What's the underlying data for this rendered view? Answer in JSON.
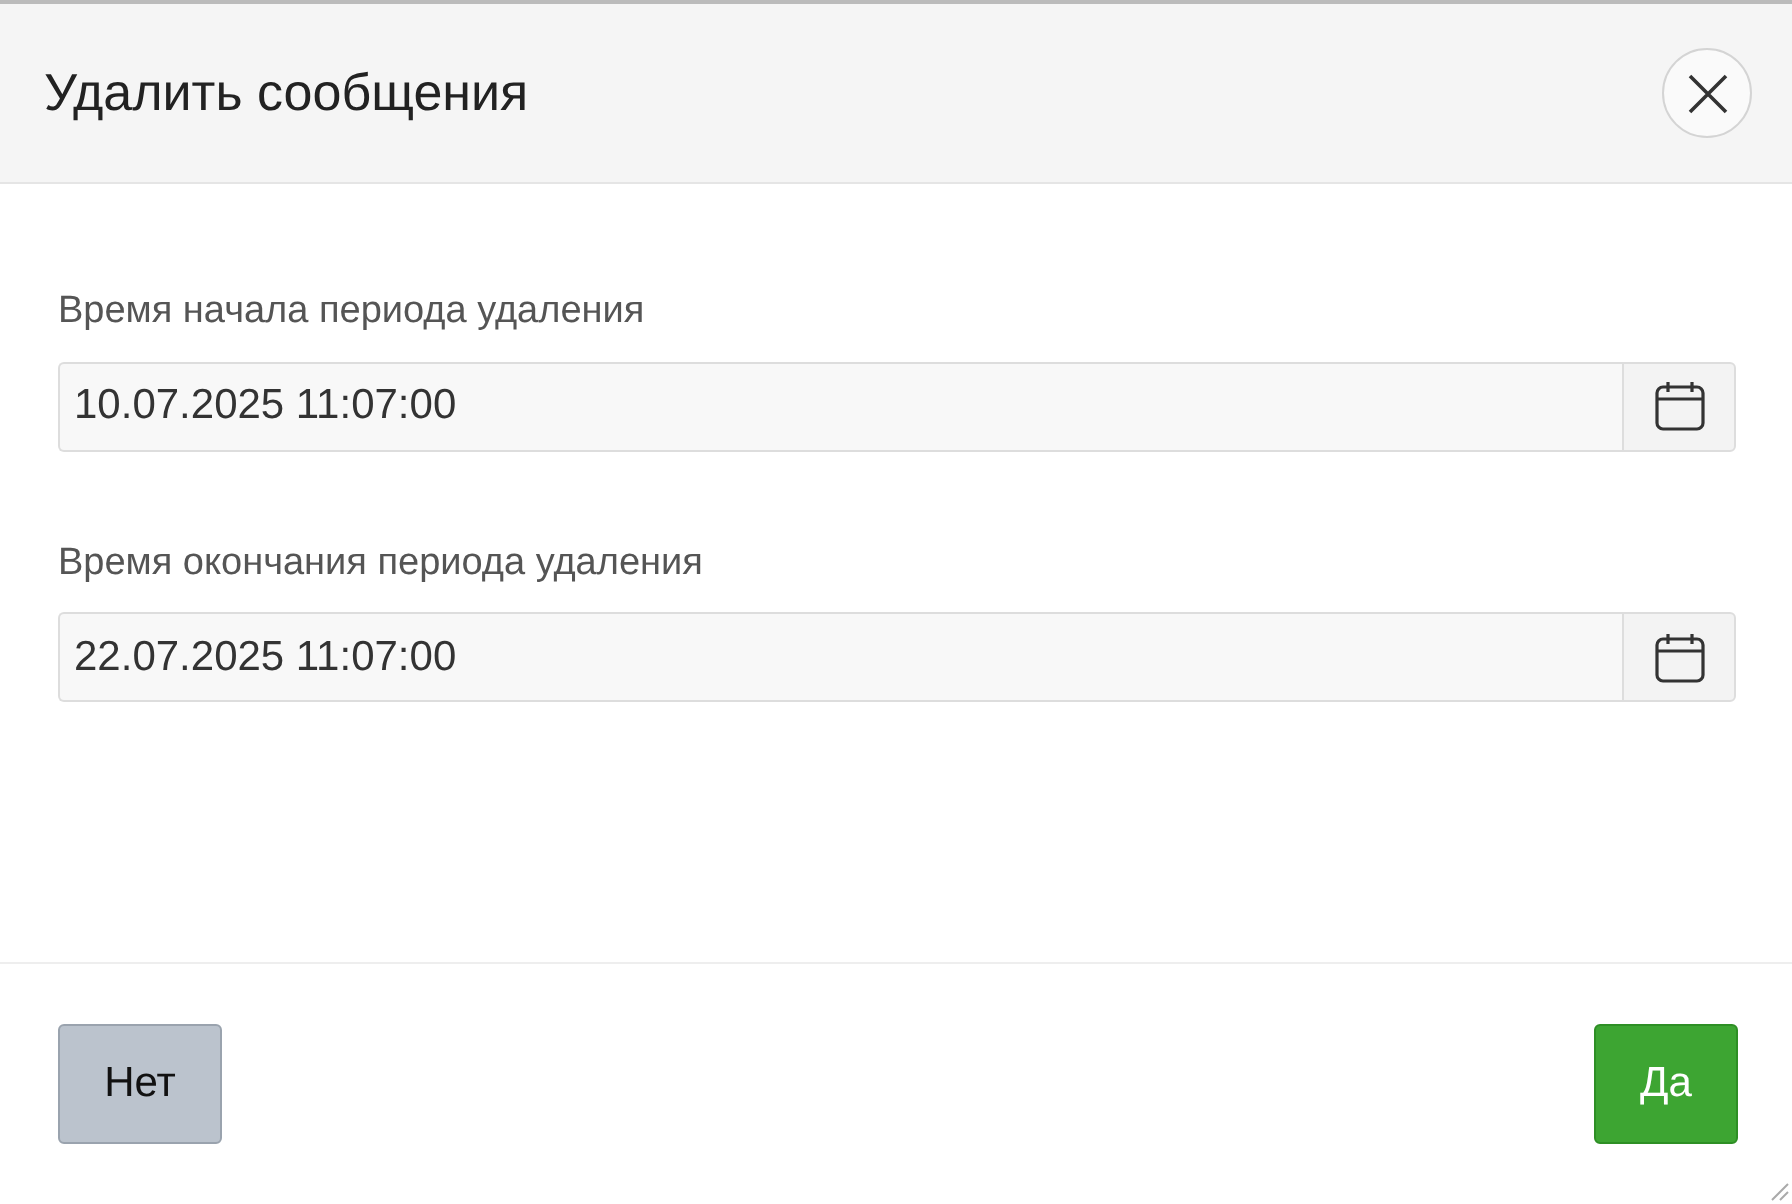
{
  "dialog": {
    "title": "Удалить сообщения"
  },
  "fields": [
    {
      "label": "Время начала периода удаления",
      "value": "10.07.2025 11:07:00"
    },
    {
      "label": "Время окончания периода удаления",
      "value": "22.07.2025 11:07:00"
    }
  ],
  "buttons": [
    {
      "label": "Нет",
      "kind": "cancel"
    },
    {
      "label": "Да",
      "kind": "confirm"
    }
  ]
}
